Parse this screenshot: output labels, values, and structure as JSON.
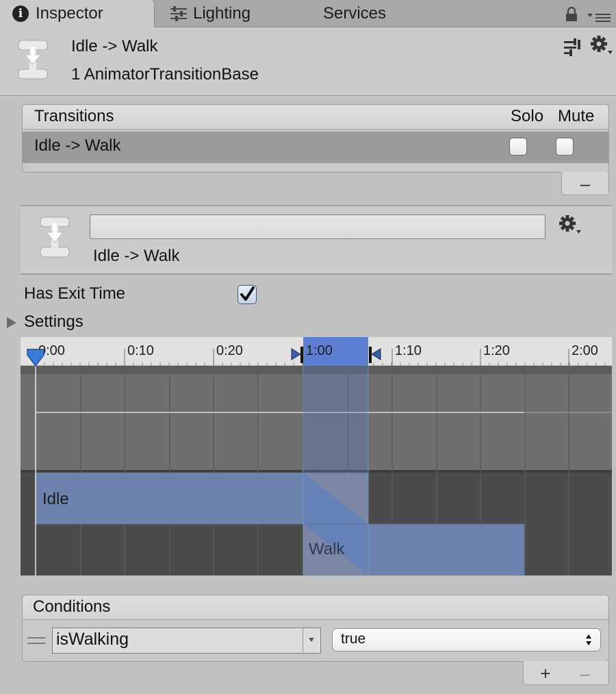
{
  "tabs": [
    {
      "label": "Inspector",
      "icon": "info-icon"
    },
    {
      "label": "Lighting",
      "icon": "sliders-icon"
    },
    {
      "label": "Services"
    }
  ],
  "header": {
    "title": "Idle -> Walk",
    "subtitle": "1 AnimatorTransitionBase",
    "icon": "transition-icon"
  },
  "transitions": {
    "title": "Transitions",
    "solo_label": "Solo",
    "mute_label": "Mute",
    "rows": [
      {
        "label": "Idle -> Walk",
        "solo": false,
        "mute": false
      }
    ],
    "remove_label": "–"
  },
  "transition_object": {
    "name_value": "",
    "label": "Idle -> Walk"
  },
  "has_exit_time": {
    "label": "Has Exit Time",
    "checked": true
  },
  "settings": {
    "label": "Settings",
    "expanded": false
  },
  "timeline": {
    "ticks": [
      "0:00",
      "0:10",
      "0:20",
      "1:00",
      "1:10",
      "1:20",
      "2:00"
    ],
    "clips": [
      {
        "name": "Idle",
        "color": "#6b83ad"
      },
      {
        "name": "Walk",
        "color": "#6b83ad"
      }
    ],
    "transition_highlight_color": "#5c7fd1"
  },
  "conditions": {
    "title": "Conditions",
    "items": [
      {
        "parameter": "isWalking",
        "value": "true"
      }
    ],
    "add_label": "+",
    "remove_label": "–"
  }
}
